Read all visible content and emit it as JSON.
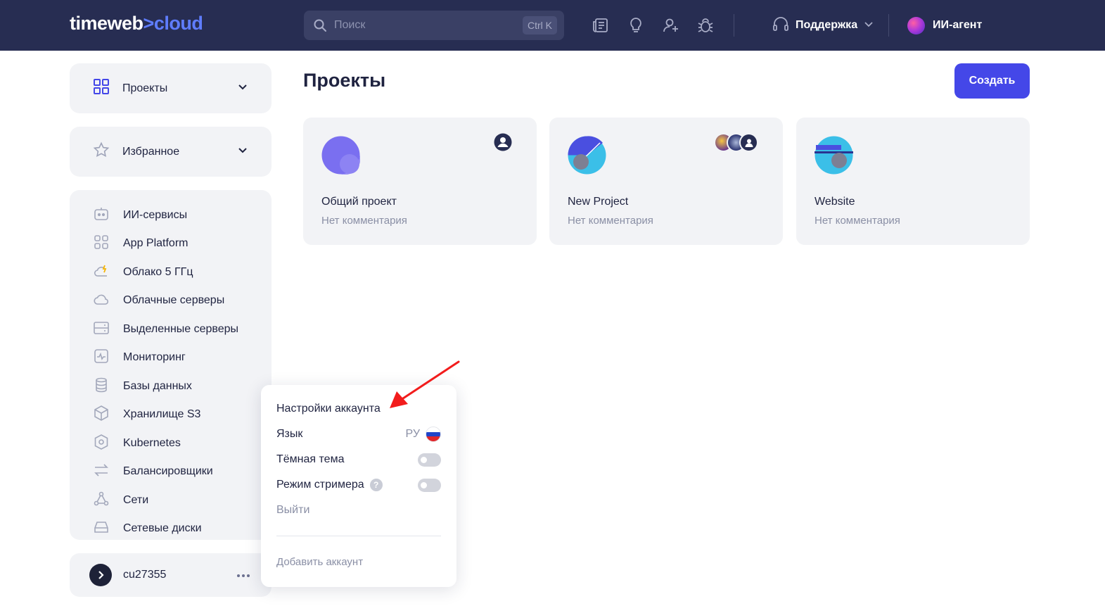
{
  "header": {
    "logo_main": "timeweb",
    "logo_arrow": ">",
    "logo_accent": "cloud",
    "search_placeholder": "Поиск",
    "search_shortcut": "Ctrl K",
    "icons": [
      "news-icon",
      "lightbulb-icon",
      "add-user-icon",
      "bug-icon"
    ],
    "support_label": "Поддержка",
    "agent_label": "ИИ-агент"
  },
  "sidebar": {
    "projects_label": "Проекты",
    "favorites_label": "Избранное",
    "items": [
      {
        "label": "ИИ-сервисы",
        "icon": "robot-icon"
      },
      {
        "label": "App Platform",
        "icon": "grid-icon"
      },
      {
        "label": "Облако 5 ГГц",
        "icon": "cloud-bolt-icon"
      },
      {
        "label": "Облачные серверы",
        "icon": "cloud-icon"
      },
      {
        "label": "Выделенные серверы",
        "icon": "server-icon"
      },
      {
        "label": "Мониторинг",
        "icon": "monitoring-icon"
      },
      {
        "label": "Базы данных",
        "icon": "database-icon"
      },
      {
        "label": "Хранилище S3",
        "icon": "cube-icon"
      },
      {
        "label": "Kubernetes",
        "icon": "kubernetes-icon"
      },
      {
        "label": "Балансировщики",
        "icon": "arrows-icon"
      },
      {
        "label": "Сети",
        "icon": "network-icon"
      },
      {
        "label": "Сетевые диски",
        "icon": "disk-icon"
      }
    ],
    "account_name": "cu27355"
  },
  "main": {
    "title": "Проекты",
    "create_label": "Создать",
    "projects": [
      {
        "name": "Общий проект",
        "comment": "Нет комментария"
      },
      {
        "name": "New Project",
        "comment": "Нет комментария"
      },
      {
        "name": "Website",
        "comment": "Нет комментария"
      }
    ]
  },
  "account_menu": {
    "settings_label": "Настройки аккаунта",
    "language_label": "Язык",
    "language_value": "РУ",
    "dark_theme_label": "Тёмная тема",
    "dark_theme_enabled": false,
    "streamer_mode_label": "Режим стримера",
    "streamer_mode_enabled": false,
    "help_glyph": "?",
    "logout_label": "Выйти",
    "add_account_label": "Добавить аккаунт"
  },
  "colors": {
    "header_bg": "#272d52",
    "accent": "#4447e8",
    "logo_accent": "#5f7dff",
    "card_bg": "#f2f3f6",
    "annotation_arrow": "#f21c1c"
  }
}
